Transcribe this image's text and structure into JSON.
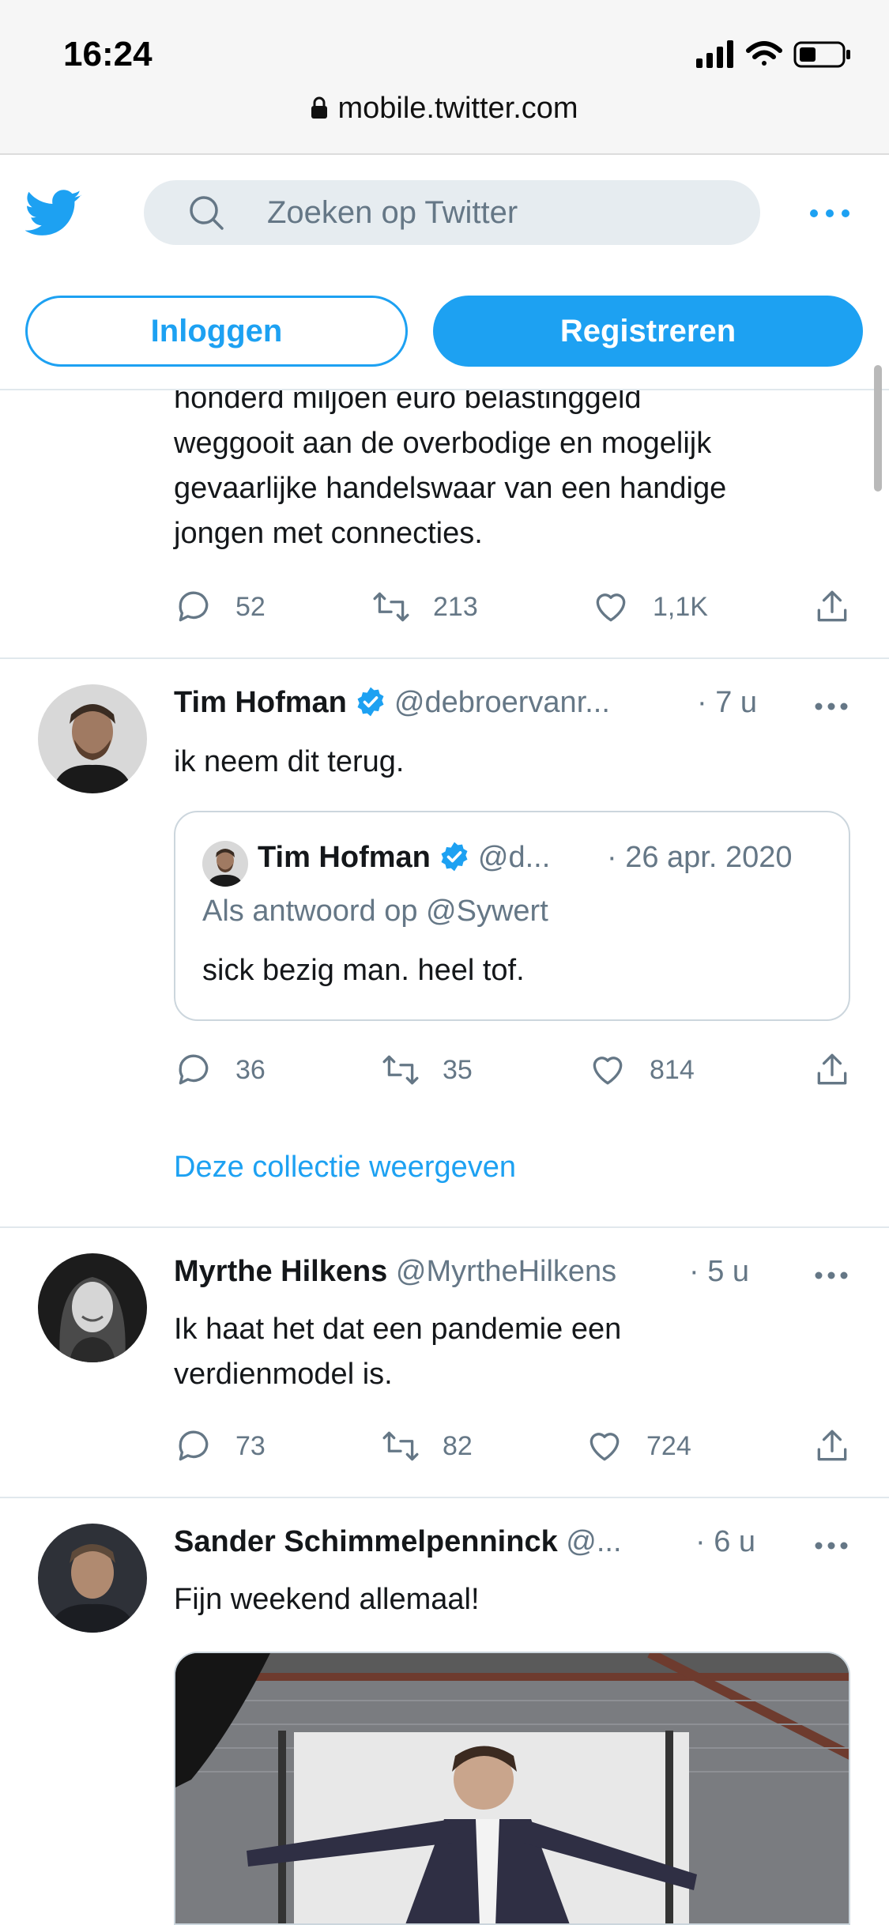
{
  "status_bar": {
    "time": "16:24"
  },
  "browser": {
    "url": "mobile.twitter.com"
  },
  "header": {
    "search_placeholder": "Zoeken op Twitter",
    "login_label": "Inloggen",
    "register_label": "Registreren"
  },
  "tweets": [
    {
      "text_lines": [
        "honderd miljoen euro belastinggeld",
        "weggooit aan de overbodige en mogelijk",
        "gevaarlijke handelswaar van een handige",
        "jongen met connecties."
      ],
      "replies": "52",
      "retweets": "213",
      "likes": "1,1K"
    },
    {
      "name": "Tim Hofman",
      "handle": "@debroervanr...",
      "time": "· 7 u",
      "text": "ik neem dit terug.",
      "quote": {
        "name": "Tim Hofman",
        "handle": "@d...",
        "time": "· 26 apr. 2020",
        "reply_to": "Als antwoord op @Sywert",
        "text": "sick bezig man. heel tof."
      },
      "replies": "36",
      "retweets": "35",
      "likes": "814",
      "collection_link": "Deze collectie weergeven"
    },
    {
      "name": "Myrthe Hilkens",
      "handle": "@MyrtheHilkens",
      "time": "· 5 u",
      "text_lines": [
        "Ik haat het dat een pandemie een",
        "verdienmodel is."
      ],
      "replies": "73",
      "retweets": "82",
      "likes": "724"
    },
    {
      "name": "Sander Schimmelpenninck",
      "handle": "@...",
      "time": "· 6 u",
      "text": "Fijn weekend allemaal!"
    }
  ],
  "colors": {
    "twitter_blue": "#1da1f2",
    "secondary_text": "#657786",
    "border": "#e1e8ed"
  }
}
